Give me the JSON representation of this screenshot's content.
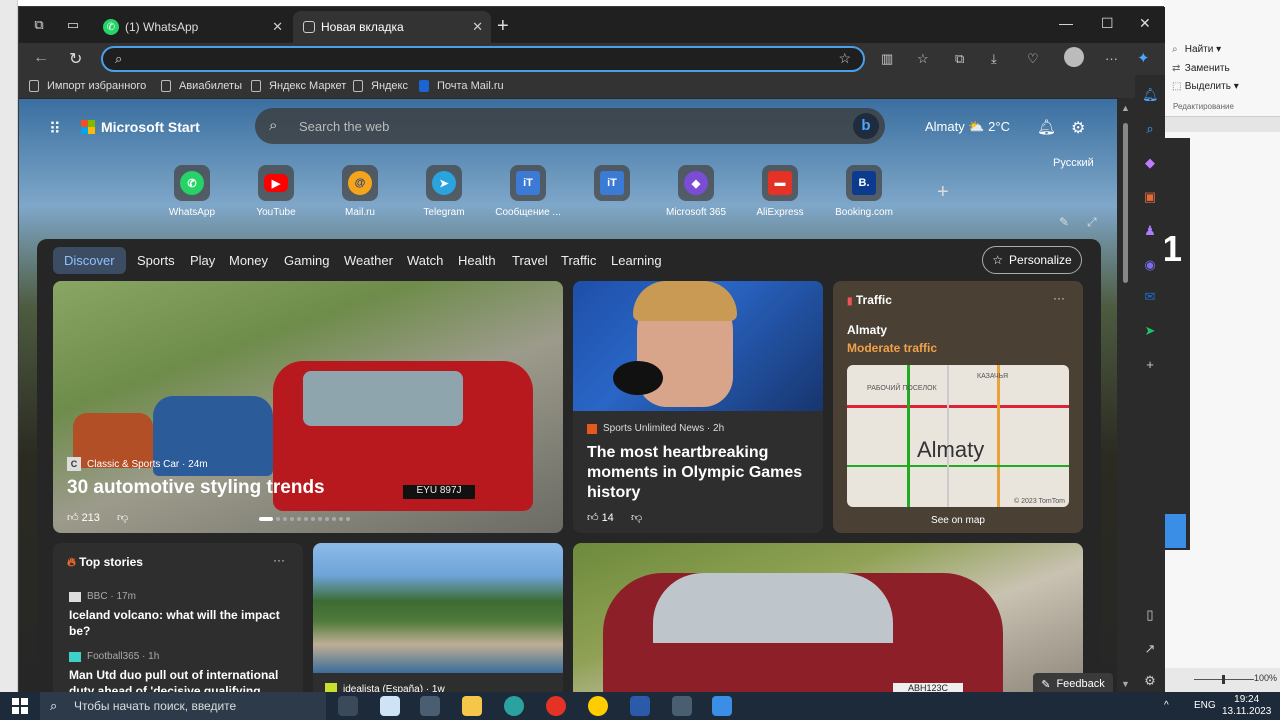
{
  "word": {
    "ribbon": [
      "Найти",
      "Заменить",
      "Выделить"
    ],
    "group": "Редактирование",
    "big_digit": "1",
    "zoom": "100%"
  },
  "browser": {
    "tabs": [
      {
        "label": "(1) WhatsApp",
        "icon": "whatsapp-icon"
      },
      {
        "label": "Новая вкладка",
        "icon": "new-tab-icon"
      }
    ],
    "favorites": [
      "Импорт избранного",
      "Авиабилеты",
      "Яндекс Маркет",
      "Яндекс",
      "Почта Mail.ru"
    ]
  },
  "msn": {
    "brand": "Microsoft Start",
    "search_placeholder": "Search the web",
    "bing_label": "b",
    "weather": "Almaty",
    "temp": "2°C",
    "language": "Русский",
    "quicklinks": [
      {
        "label": "WhatsApp",
        "glyph": "✆",
        "color": "#25d366"
      },
      {
        "label": "YouTube",
        "glyph": "▶",
        "color": "#ff0000"
      },
      {
        "label": "Mail.ru",
        "glyph": "@",
        "color": "#f6a41a"
      },
      {
        "label": "Telegram",
        "glyph": "➤",
        "color": "#2aa3de"
      },
      {
        "label": "Сообщение ...",
        "glyph": "iT",
        "color": "#3b7bd6"
      },
      {
        "label": "",
        "glyph": "iT",
        "color": "#3b7bd6"
      },
      {
        "label": "Microsoft 365",
        "glyph": "◆",
        "color": "#7b4dd6"
      },
      {
        "label": "AliExpress",
        "glyph": "▬",
        "color": "#e43225"
      },
      {
        "label": "Booking.com",
        "glyph": "B.",
        "color": "#0a3b8f"
      }
    ],
    "nav": [
      "Discover",
      "Sports",
      "Play",
      "Money",
      "Gaming",
      "Weather",
      "Watch",
      "Health",
      "Travel",
      "Traffic",
      "Learning"
    ],
    "personalize": "Personalize",
    "hero": {
      "source": "Classic & Sports Car · 24m",
      "source_icon": "C",
      "title": "30 automotive styling trends",
      "likes": "213",
      "plate": "EYU 897J"
    },
    "olympic": {
      "source": "Sports Unlimited News · 2h",
      "title": "The most heartbreaking moments in Olympic Games history",
      "likes": "14"
    },
    "traffic": {
      "header": "Traffic",
      "city": "Almaty",
      "status": "Moderate traffic",
      "map_label": "Almaty",
      "copyright": "© 2023 TomTom",
      "see_map": "See on map",
      "map_words": [
        "РАБОЧИЙ ПОСЕЛОК",
        "КАЗАЧЬЯ"
      ]
    },
    "top_stories": {
      "header": "Top stories",
      "items": [
        {
          "source": "BBC · 17m",
          "title": "Iceland volcano: what will the impact be?"
        },
        {
          "source": "Football365 · 1h",
          "title": "Man Utd duo pull out of international duty ahead of 'decisive qualifying"
        }
      ]
    },
    "idealista": {
      "source": "idealista (España) · 1w",
      "icon": "id"
    },
    "bigcar_plate": "ABH123C",
    "feedback": "Feedback"
  },
  "taskbar": {
    "search_placeholder": "Чтобы начать поиск, введите",
    "lang": "ENG",
    "time": "19:24",
    "date": "13.11.2023",
    "apps": [
      {
        "name": "task-view",
        "color": "#3a4a5a"
      },
      {
        "name": "notepad",
        "color": "#cfe3f7"
      },
      {
        "name": "calculator",
        "color": "#4a5e72"
      },
      {
        "name": "file-explorer",
        "color": "#f6c64a"
      },
      {
        "name": "edge",
        "color": "#2aa3a0"
      },
      {
        "name": "yandex-browser",
        "color": "#e43225"
      },
      {
        "name": "yandex-music",
        "color": "#ffcc00"
      },
      {
        "name": "word",
        "color": "#2b5ba8"
      },
      {
        "name": "calendar",
        "color": "#4a5e72"
      },
      {
        "name": "photos",
        "color": "#3a8ee6"
      }
    ]
  },
  "colors": {
    "accent": "#4a9fe8",
    "traffic_status": "#f0a24a",
    "nav_active": "#8dc1ff"
  }
}
